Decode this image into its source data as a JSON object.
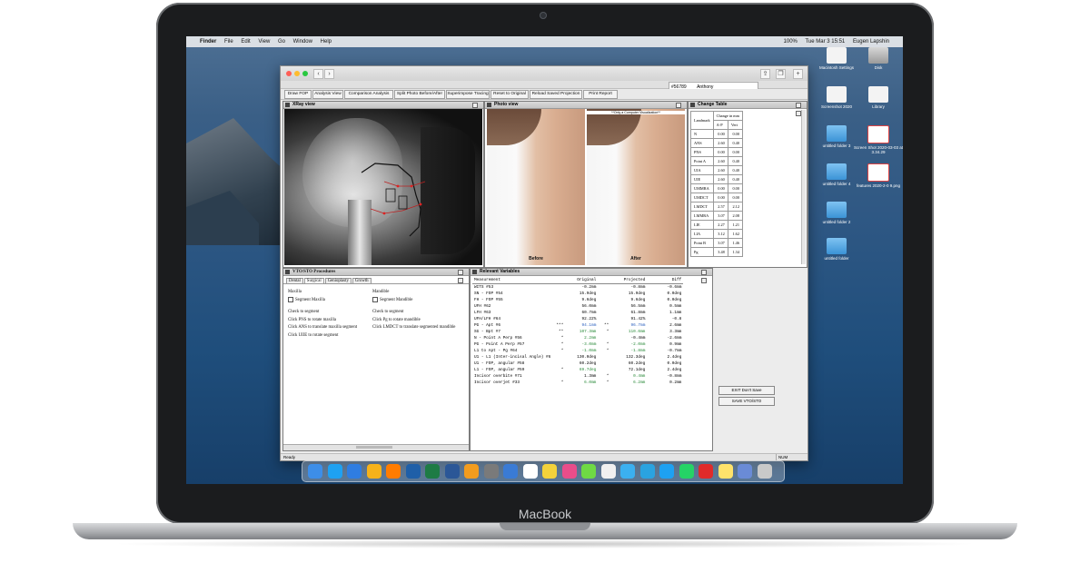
{
  "device": {
    "brand": "MacBook"
  },
  "menubar": {
    "apple": "",
    "items": [
      "Finder",
      "File",
      "Edit",
      "View",
      "Go",
      "Window",
      "Help"
    ],
    "right": {
      "battery": "100%",
      "datetime": "Tue Mar 3 15:51",
      "user": "Eugen Lapshin"
    }
  },
  "desktop_icons": [
    {
      "label": "Macintosh Settings",
      "kind": "doc"
    },
    {
      "label": "Disk",
      "kind": "disk"
    },
    {
      "label": "Screenshot 2020",
      "kind": "doc"
    },
    {
      "label": "Library",
      "kind": "doc"
    },
    {
      "label": "untitled folder 3",
      "kind": "folder"
    },
    {
      "label": "Screen Shot 2020-03-03 at 3.34.29",
      "kind": "pdf"
    },
    {
      "label": "untitled folder 4",
      "kind": "folder"
    },
    {
      "label": "features 2020-2-0 9.png",
      "kind": "pdf"
    },
    {
      "label": "untitled folder 2",
      "kind": "folder"
    },
    {
      "label": "untitled folder",
      "kind": "folder"
    }
  ],
  "window": {
    "lookup": {
      "id": "#56789",
      "name": "Anthony"
    },
    "toolbar": [
      "Draw FOP",
      "Analysis View",
      "Comparison Analysis",
      "Split Photo Before/After",
      "Superimpose Tracing",
      "Reset to Original",
      "Reload Saved Projection",
      "Print Report"
    ],
    "status": {
      "ready": "Ready",
      "num": "NUM"
    }
  },
  "xray": {
    "title": "XRay view"
  },
  "photo": {
    "title": "Photo view",
    "stamp": "**Only a Computer Visualization**",
    "before": "Before",
    "after": "After"
  },
  "change_table": {
    "title": "Change Table",
    "header": {
      "landmark": "Landmark",
      "change": "Change in mm",
      "ap": "A-P",
      "vert": "Vert"
    },
    "rows": [
      [
        "N",
        "0.00",
        "0.00"
      ],
      [
        "ANS",
        "2.60",
        "0.40"
      ],
      [
        "PNS",
        "0.00",
        "0.00"
      ],
      [
        "Point A",
        "2.60",
        "0.40"
      ],
      [
        "UIA",
        "2.60",
        "0.40"
      ],
      [
        "UIE",
        "2.60",
        "0.40"
      ],
      [
        "UMMRA",
        "0.00",
        "0.00"
      ],
      [
        "UMDCT",
        "0.00",
        "0.00"
      ],
      [
        "LMDCT",
        "2.57",
        "2.12"
      ],
      [
        "LMMRA",
        "3.07",
        "2.08"
      ],
      [
        "LIE",
        "2.27",
        "1.21"
      ],
      [
        "LIA",
        "3.12",
        "1.62"
      ],
      [
        "Point B",
        "3.07",
        "1.46"
      ],
      [
        "Pg",
        "3.48",
        "1.34"
      ]
    ]
  },
  "vto": {
    "title": "VTO/STO Procedures",
    "tabs": [
      "Dental",
      "Surgical",
      "Genioplasty",
      "Growth"
    ],
    "maxilla": {
      "heading": "Maxilla",
      "checkbox": "Segment Maxilla",
      "lines": [
        "Check to segment",
        "Click PNS to rotate maxilla",
        "Click ANS to translate maxilla segment",
        "Click UIIE to rotate segment"
      ]
    },
    "mandible": {
      "heading": "Mandible",
      "checkbox": "Segment Mandible",
      "lines": [
        "Check to segment",
        "Click Pg to rotate mandible",
        "Click LMDCT to translate segmented mandible"
      ]
    }
  },
  "variables": {
    "title": "Relevant Variables",
    "columns": [
      "Measurement",
      "Original",
      "Projected",
      "Diff"
    ],
    "rows": [
      [
        "WITS #53",
        "",
        "-0.2mm",
        "",
        "-0.8mm",
        "-0.6mm"
      ],
      [
        "SN - FOP #54",
        "",
        "15.9deg",
        "",
        "15.9deg",
        "0.0deg"
      ],
      [
        "FH - FOP #55",
        "",
        "9.6deg",
        "",
        "9.6deg",
        "0.0deg"
      ],
      [
        "UFH #62",
        "",
        "56.0mm",
        "",
        "56.5mm",
        "0.5mm"
      ],
      [
        "LFH #63",
        "",
        "60.7mm",
        "",
        "61.8mm",
        "1.1mm"
      ],
      [
        "UFH/LFH #64",
        "",
        "92.22%",
        "",
        "91.42%",
        "-0.8"
      ],
      [
        "PG - Apt #6",
        "***",
        "94.1mm",
        "**",
        "96.7mm",
        "2.6mm"
      ],
      [
        "SG - Bpt #7",
        "**",
        "107.3mm",
        "*",
        "110.6mm",
        "3.3mm"
      ],
      [
        "N - Point A Perp #56",
        "*",
        "2.2mm",
        "",
        "-0.4mm",
        "-2.6mm"
      ],
      [
        "PG - Point A Perp #57",
        "*",
        "-3.0mm",
        "*",
        "-2.0mm",
        "0.9mm"
      ],
      [
        "L1 to Apt - Pg #64",
        "*",
        "-1.0mm",
        "*",
        "-1.8mm",
        "-0.7mm"
      ],
      [
        "U1 - L1 (Inter-incisal Angle) #6",
        "",
        "130.0deg",
        "",
        "132.3deg",
        "2.4deg"
      ],
      [
        "U1 - FOP, angular #58",
        "",
        "60.2deg",
        "",
        "60.2deg",
        "0.0deg"
      ],
      [
        "L1 - FOP, angular #59",
        "*",
        "69.7deg",
        "",
        "72.1deg",
        "2.4deg"
      ],
      [
        "Incisor overbite #71",
        "",
        "1.3mm",
        "*",
        "0.4mm",
        "-0.8mm"
      ],
      [
        "Incisor overjet #33",
        "*",
        "6.0mm",
        "*",
        "6.2mm",
        "0.2mm"
      ]
    ]
  },
  "side_buttons": {
    "exit": "EXIT Don't Save",
    "save": "SAVE VTO/STO"
  },
  "dock": {
    "apps": [
      "Finder",
      "Skype",
      "Safari",
      "Sketch",
      "Illustrator",
      "Photoshop",
      "Excel",
      "Word",
      "Pages",
      "Preview",
      "Mail",
      "Calendar",
      "Notes",
      "Photos",
      "Upwork",
      "iTunes",
      "Messages",
      "Telegram",
      "Skype2",
      "WhatsApp",
      "Opera",
      "Stickies",
      "Downloads",
      "Trash"
    ]
  }
}
